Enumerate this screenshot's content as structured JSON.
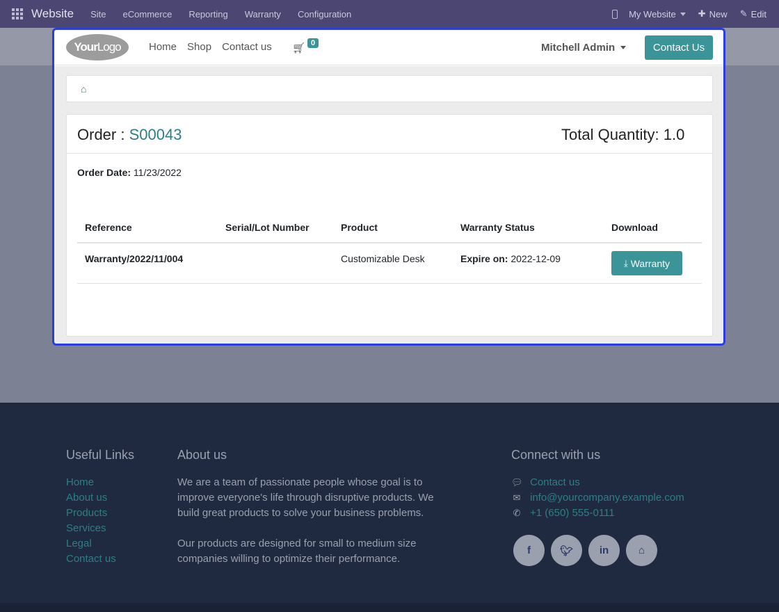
{
  "topbar": {
    "brand": "Website",
    "menu": [
      "Site",
      "eCommerce",
      "Reporting",
      "Warranty",
      "Configuration"
    ],
    "my_website": "My Website",
    "new_label": "New",
    "edit_label": "Edit"
  },
  "navbar": {
    "logo_bold": "Your",
    "logo_light": "Logo",
    "links": [
      "Home",
      "Shop",
      "Contact us"
    ],
    "cart_count": "0",
    "user": "Mitchell Admin",
    "contact_button": "Contact Us"
  },
  "order": {
    "title_prefix": "Order : ",
    "number": "S00043",
    "total_quantity": "Total Quantity: 1.0",
    "date_label": "Order Date:",
    "date_value": "11/23/2022"
  },
  "table": {
    "headers": [
      "Reference",
      "Serial/Lot Number",
      "Product",
      "Warranty Status",
      "Download"
    ],
    "rows": [
      {
        "reference": "Warranty/2022/11/004",
        "serial": "",
        "product": "Customizable Desk",
        "status_label": "Expire on:",
        "status_value": "2022-12-09",
        "download_label": "Warranty"
      }
    ]
  },
  "footer": {
    "useful_links_title": "Useful Links",
    "useful_links": [
      "Home",
      "About us",
      "Products",
      "Services",
      "Legal",
      "Contact us"
    ],
    "about_title": "About us",
    "about_p1": "We are a team of passionate people whose goal is to improve everyone's life through disruptive products. We build great products to solve your business problems.",
    "about_p2": "Our products are designed for small to medium size companies willing to optimize their performance.",
    "connect_title": "Connect with us",
    "contact_us": "Contact us",
    "email": "info@yourcompany.example.com",
    "phone": "+1 (650) 555-0111",
    "socials": [
      "facebook-icon",
      "twitter-icon",
      "linkedin-icon",
      "home-icon"
    ]
  },
  "colors": {
    "primary": "#3a9498",
    "topbar": "#4c4772",
    "footer": "#1f2940",
    "frame_border": "#2a3ee0"
  }
}
